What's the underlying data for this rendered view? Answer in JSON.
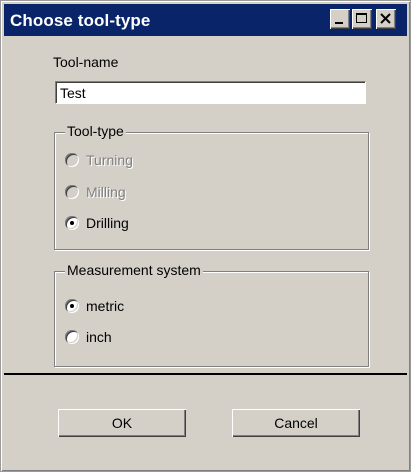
{
  "window": {
    "title": "Choose tool-type",
    "controls": {
      "minimize_icon": "minimize-icon",
      "maximize_icon": "maximize-icon",
      "close_icon": "close-icon"
    }
  },
  "form": {
    "tool_name_label": "Tool-name",
    "tool_name_value": "Test",
    "tool_type": {
      "legend": "Tool-type",
      "options": [
        {
          "label": "Turning",
          "selected": false,
          "enabled": false
        },
        {
          "label": "Milling",
          "selected": false,
          "enabled": false
        },
        {
          "label": "Drilling",
          "selected": true,
          "enabled": true
        }
      ]
    },
    "measurement": {
      "legend": "Measurement system",
      "options": [
        {
          "label": "metric",
          "selected": true,
          "enabled": true
        },
        {
          "label": "inch",
          "selected": false,
          "enabled": true
        }
      ]
    }
  },
  "buttons": {
    "ok_label": "OK",
    "cancel_label": "Cancel"
  },
  "colors": {
    "titlebar": "#0a246a",
    "face": "#d4d0c8"
  }
}
